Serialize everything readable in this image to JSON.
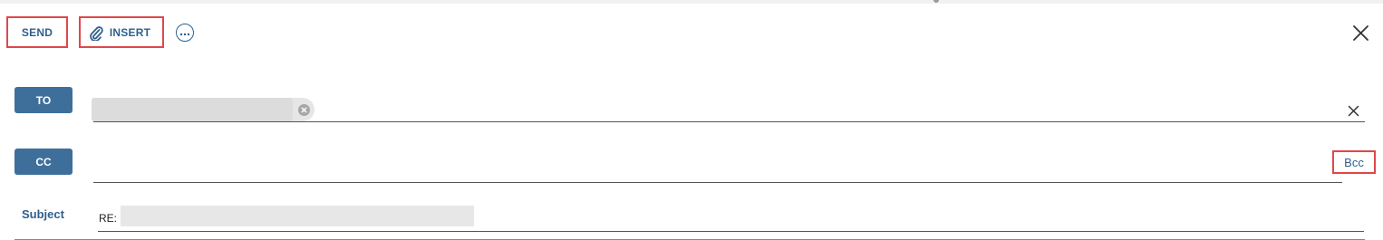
{
  "toolbar": {
    "send_label": "SEND",
    "insert_label": "INSERT",
    "more_icon": "more-horizontal-icon",
    "close_icon": "close-icon",
    "insert_icon": "paperclip-icon"
  },
  "fields": {
    "to_label": "TO",
    "cc_label": "CC",
    "bcc_label": "Bcc",
    "subject_label": "Subject",
    "subject_prefix": "RE:"
  },
  "colors": {
    "accent": "#2f5f8c",
    "field_button": "#3e6f9a",
    "highlight_border": "#e0474a"
  }
}
